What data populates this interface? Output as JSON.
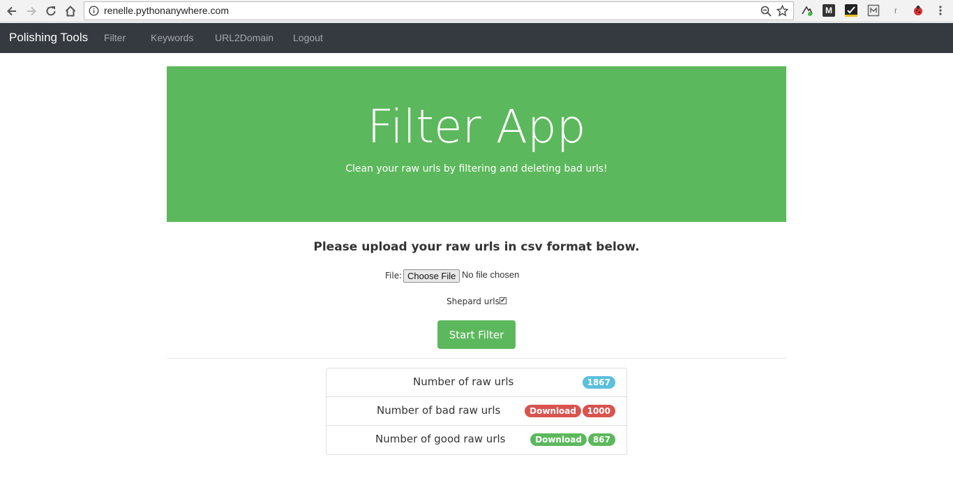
{
  "browser": {
    "url": "renelle.pythonanywhere.com",
    "extension_m_label": "M",
    "extension_r_label": "r"
  },
  "navbar": {
    "brand": "Polishing Tools",
    "links": [
      "Filter",
      "Keywords",
      "URL2Domain",
      "Logout"
    ]
  },
  "hero": {
    "title": "Filter App",
    "subtitle": "Clean your raw urls by filtering and deleting bad urls!"
  },
  "upload": {
    "heading": "Please upload your raw urls in csv format below.",
    "file_label": "File:",
    "choose_button": "Choose File",
    "file_status": "No file chosen",
    "shepard_label": "Shepard urls:",
    "shepard_checked": true,
    "start_button": "Start Filter"
  },
  "results": {
    "raw": {
      "label": "Number of raw urls",
      "count": "1867"
    },
    "bad": {
      "label": "Number of bad raw urls",
      "download": "Download",
      "count": "1000"
    },
    "good": {
      "label": "Number of good raw urls",
      "download": "Download",
      "count": "867"
    }
  },
  "colors": {
    "navbar_bg": "#343a40",
    "hero_bg": "#5cb85c",
    "badge_info": "#5bc0de",
    "badge_danger": "#d9534f",
    "badge_success": "#5cb85c"
  }
}
